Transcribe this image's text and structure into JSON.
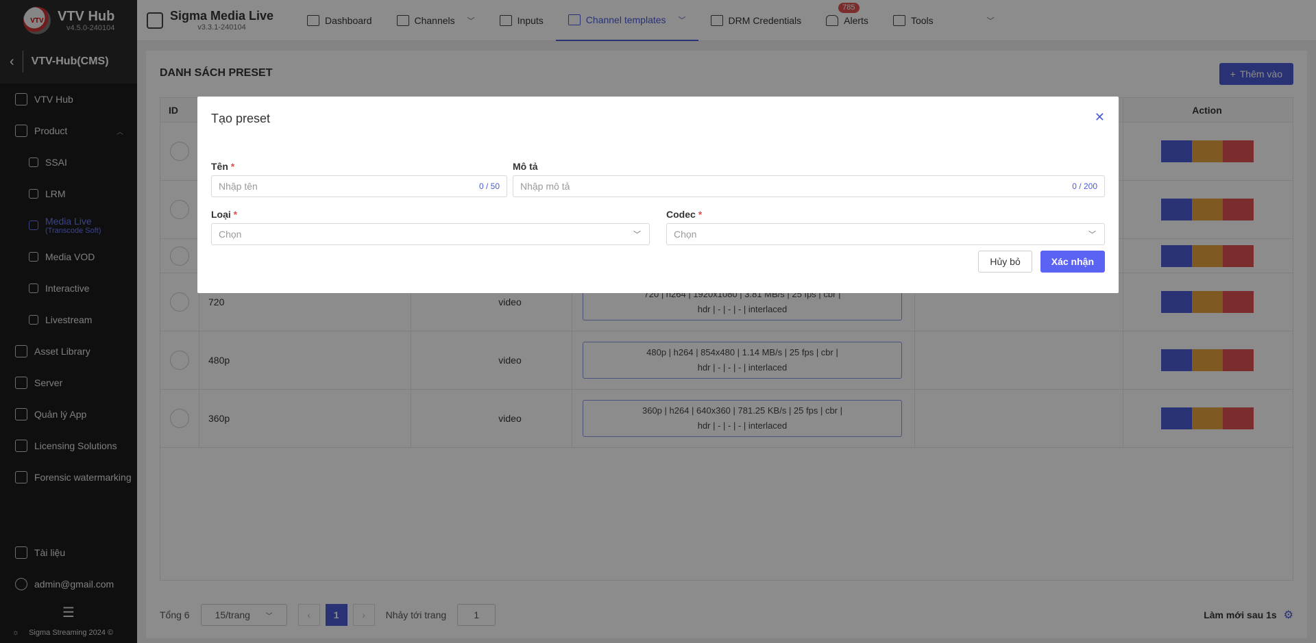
{
  "sidebar": {
    "brand_title": "VTV Hub",
    "brand_version": "v4.5.0-240104",
    "logo_text": "VTV",
    "section_title": "VTV-Hub(CMS)",
    "items": [
      {
        "label": "VTV Hub"
      },
      {
        "label": "Product"
      },
      {
        "label": "SSAI"
      },
      {
        "label": "LRM"
      },
      {
        "label": "Media Live",
        "sub": "(Transcode Soft)"
      },
      {
        "label": "Media VOD"
      },
      {
        "label": "Interactive"
      },
      {
        "label": "Livestream"
      },
      {
        "label": "Asset Library"
      },
      {
        "label": "Server"
      },
      {
        "label": "Quản lý App"
      },
      {
        "label": "Licensing Solutions"
      },
      {
        "label": "Forensic watermarking"
      }
    ],
    "docs": "Tài liệu",
    "user": "admin@gmail.com",
    "footer": "Sigma Streaming 2024 ©"
  },
  "topbar": {
    "app_title": "Sigma Media Live",
    "app_version": "v3.3.1-240104",
    "tabs": [
      {
        "label": "Dashboard"
      },
      {
        "label": "Channels"
      },
      {
        "label": "Inputs"
      },
      {
        "label": "Channel templates"
      },
      {
        "label": "DRM Credentials"
      },
      {
        "label": "Alerts",
        "badge": "785"
      },
      {
        "label": "Tools"
      }
    ]
  },
  "main": {
    "title": "DANH SÁCH PRESET",
    "add_label": "Thêm vào",
    "columns": {
      "id": "ID",
      "action": "Action"
    },
    "rows": [
      {
        "name": "720",
        "type": "video",
        "spec1": "720 | h264 | 1920x1080 | 3.81 MB/s | 25 fps | cbr |",
        "spec2": "hdr | - | - | - | interlaced"
      },
      {
        "name": "480p",
        "type": "video",
        "spec1": "480p | h264 | 854x480 | 1.14 MB/s | 25 fps | cbr |",
        "spec2": "hdr | - | - | - | interlaced"
      },
      {
        "name": "360p",
        "type": "video",
        "spec1": "360p | h264 | 640x360 | 781.25 KB/s | 25 fps | cbr |",
        "spec2": "hdr | - | - | - | interlaced"
      }
    ],
    "pager": {
      "total": "Tổng 6",
      "per_page": "15/trang",
      "current": "1",
      "jump_label": "Nhảy tới trang",
      "jump_value": "1"
    },
    "refresh": "Làm mới sau 1s"
  },
  "modal": {
    "title": "Tạo preset",
    "name_label": "Tên",
    "name_placeholder": "Nhập tên",
    "name_count": "0 / 50",
    "desc_label": "Mô tả",
    "desc_placeholder": "Nhập mô tả",
    "desc_count": "0 / 200",
    "type_label": "Loại",
    "type_placeholder": "Chọn",
    "codec_label": "Codec",
    "codec_placeholder": "Chọn",
    "required_mark": "*",
    "cancel_label": "Hủy bỏ",
    "confirm_label": "Xác nhận"
  }
}
